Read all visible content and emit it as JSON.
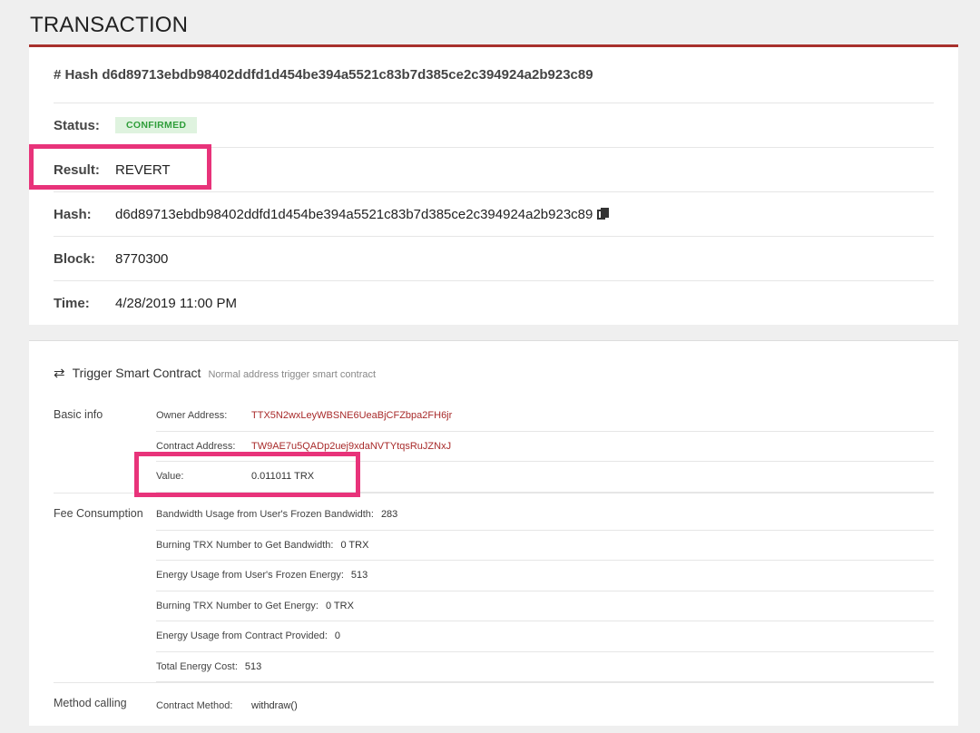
{
  "page": {
    "title": "TRANSACTION"
  },
  "summary": {
    "hash_heading": "# Hash d6d89713ebdb98402ddfd1d454be394a5521c83b7d385ce2c394924a2b923c89",
    "status": {
      "label": "Status:",
      "badge": "CONFIRMED"
    },
    "result": {
      "label": "Result:",
      "value": "REVERT"
    },
    "hash": {
      "label": "Hash:",
      "value": "d6d89713ebdb98402ddfd1d454be394a5521c83b7d385ce2c394924a2b923c89",
      "icon": "copy-icon"
    },
    "block": {
      "label": "Block:",
      "value": "8770300"
    },
    "time": {
      "label": "Time:",
      "value": "4/28/2019 11:00 PM"
    }
  },
  "contract": {
    "title": "Trigger Smart Contract",
    "subtitle": "Normal address trigger smart contract",
    "icon": "swap-arrows-icon",
    "basic_info": {
      "label": "Basic info",
      "owner_address": {
        "key": "Owner Address:",
        "value": "TTX5N2wxLeyWBSNE6UeaBjCFZbpa2FH6jr"
      },
      "contract_address": {
        "key": "Contract Address:",
        "value": "TW9AE7u5QADp2uej9xdaNVTYtqsRuJZNxJ"
      },
      "value": {
        "key": "Value:",
        "value": "0.011011 TRX"
      }
    },
    "fee_consumption": {
      "label": "Fee Consumption",
      "bandwidth_frozen": {
        "key": "Bandwidth Usage from User's Frozen Bandwidth:",
        "value": "283"
      },
      "burn_bandwidth": {
        "key": "Burning TRX Number to Get Bandwidth:",
        "value": "0 TRX"
      },
      "energy_frozen": {
        "key": "Energy Usage from User's Frozen Energy:",
        "value": "513"
      },
      "burn_energy": {
        "key": "Burning TRX Number to Get Energy:",
        "value": "0 TRX"
      },
      "energy_contract": {
        "key": "Energy Usage from Contract Provided:",
        "value": "0"
      },
      "total_energy": {
        "key": "Total Energy Cost:",
        "value": "513"
      }
    },
    "method_calling": {
      "label": "Method calling",
      "contract_method": {
        "key": "Contract Method:",
        "value": "withdraw()"
      }
    }
  },
  "colors": {
    "accent": "#a8302c",
    "link": "#a82a2a",
    "confirmed_bg": "#dff3df",
    "confirmed_text": "#2f9e3a",
    "highlight": "#e8337a"
  }
}
